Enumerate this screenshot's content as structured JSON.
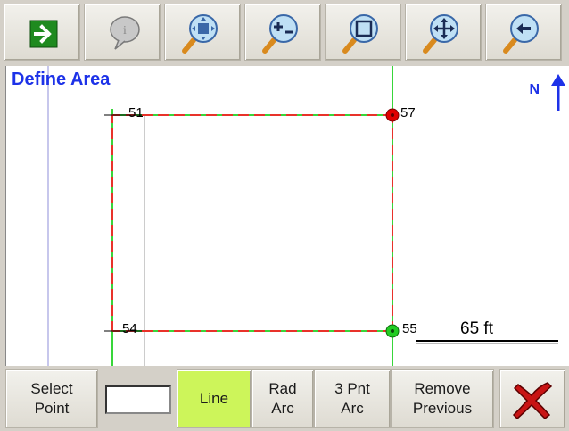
{
  "map": {
    "title": "Define Area",
    "north_label": "N",
    "points": [
      {
        "id": "51",
        "label": "51"
      },
      {
        "id": "57",
        "label": "57"
      },
      {
        "id": "54",
        "label": "54"
      },
      {
        "id": "55",
        "label": "55"
      }
    ],
    "scale_label": "65 ft"
  },
  "toolbar": {
    "buttons": [
      {
        "name": "next-button",
        "icon": "arrow-right-icon"
      },
      {
        "name": "info-button",
        "icon": "speech-bubble-icon"
      },
      {
        "name": "zoom-extents-button",
        "icon": "zoom-extents-icon"
      },
      {
        "name": "zoom-in-out-button",
        "icon": "zoom-plus-minus-icon"
      },
      {
        "name": "zoom-window-button",
        "icon": "zoom-window-icon"
      },
      {
        "name": "pan-button",
        "icon": "pan-icon"
      },
      {
        "name": "zoom-previous-button",
        "icon": "zoom-back-icon"
      }
    ]
  },
  "bottom": {
    "select_point": "Select\nPoint",
    "input_value": "",
    "line": "Line",
    "rad_arc": "Rad\nArc",
    "three_pnt_arc": "3 Pnt\nArc",
    "remove_previous": "Remove\nPrevious"
  },
  "colors": {
    "accent_blue": "#1d32e8",
    "active_button": "#cdf55a",
    "boundary_red": "#e8322a",
    "boundary_green": "#38d63a",
    "end_point_red": "#e00000",
    "start_point_green": "#22cc22"
  }
}
